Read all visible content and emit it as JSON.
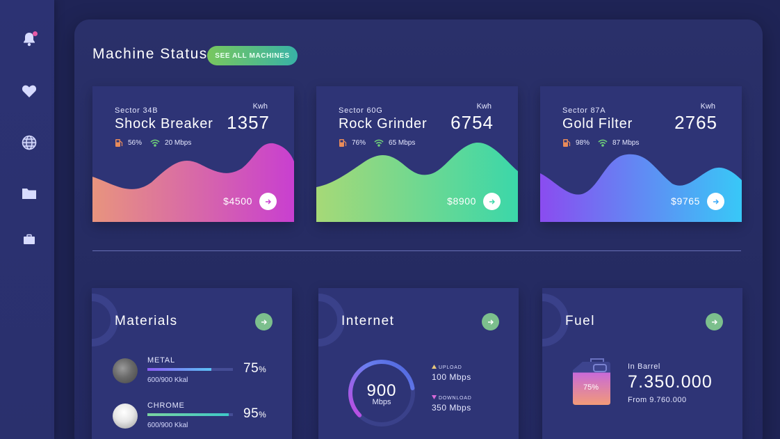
{
  "colors": {
    "accent_green": "#7cbf8d",
    "shock_breaker_gradient": [
      "#e8947e",
      "#c83fd0"
    ],
    "rock_grinder_gradient": [
      "#a6d977",
      "#3bd7a9"
    ],
    "gold_filter_gradient": [
      "#8a4cf0",
      "#38c8f7"
    ],
    "metal_bar_gradient": [
      "#8a5cf5",
      "#5bc2f5"
    ],
    "chrome_bar_gradient": [
      "#7bd4a0",
      "#3ec8c8"
    ]
  },
  "sidebar": {
    "icons": [
      "bell-icon",
      "heart-icon",
      "globe-icon",
      "folder-icon",
      "briefcase-icon"
    ]
  },
  "header": {
    "title": "Machine Status",
    "see_all_label": "SEE ALL MACHINES"
  },
  "machines": [
    {
      "sector": "Sector 34B",
      "name": "Shock Breaker",
      "unit": "Kwh",
      "value": "1357",
      "fuel_pct": "56%",
      "speed": "20 Mbps",
      "price": "$4500"
    },
    {
      "sector": "Sector 60G",
      "name": "Rock Grinder",
      "unit": "Kwh",
      "value": "6754",
      "fuel_pct": "76%",
      "speed": "65 Mbps",
      "price": "$8900"
    },
    {
      "sector": "Sector 87A",
      "name": "Gold Filter",
      "unit": "Kwh",
      "value": "2765",
      "fuel_pct": "98%",
      "speed": "87 Mbps",
      "price": "$9765"
    }
  ],
  "materials": {
    "title": "Materials",
    "items": [
      {
        "name": "METAL",
        "sub": "600/900 Kkal",
        "pct_value": "75",
        "pct_sign": "%",
        "level": 0.75
      },
      {
        "name": "CHROME",
        "sub": "600/900 Kkal",
        "pct_value": "95",
        "pct_sign": "%",
        "level": 0.95
      }
    ]
  },
  "internet": {
    "title": "Internet",
    "gauge_value": "900",
    "gauge_unit": "Mbps",
    "gauge_level": 0.8,
    "upload_label": "UPLOAD",
    "upload_value": "100 Mbps",
    "download_label": "DOWNLOAD",
    "download_value": "350 Mbps"
  },
  "fuel": {
    "title": "Fuel",
    "can_pct": "75%",
    "can_level": 0.75,
    "label": "In Barrel",
    "value": "7.350.000",
    "sub": "From 9.760.000"
  }
}
